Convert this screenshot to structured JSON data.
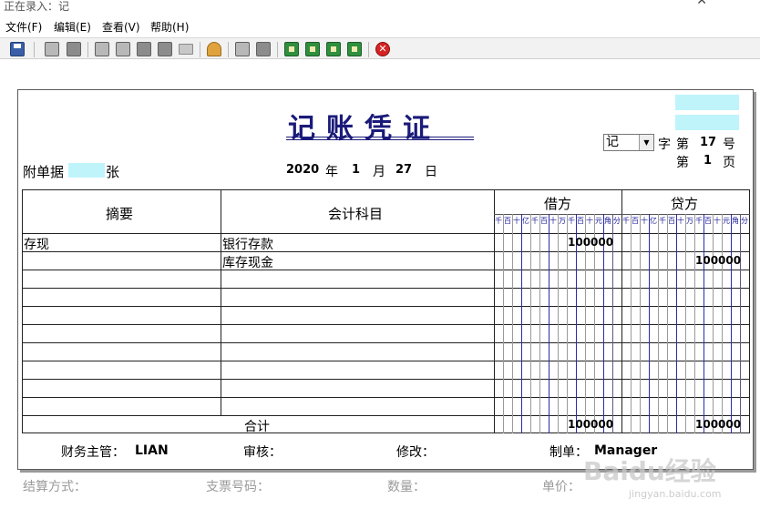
{
  "window": {
    "title": "正在录入：记"
  },
  "menu": {
    "file": "文件(F)",
    "edit": "编辑(E)",
    "view": "查看(V)",
    "help": "帮助(H)"
  },
  "voucher": {
    "title": "记账凭证",
    "kind": "记",
    "zi": "字",
    "di1": "第",
    "number": "17",
    "hao": "号",
    "di2": "第",
    "page": "1",
    "ye": "页",
    "attach_label": "附单据",
    "attach_unit": "张",
    "date_year": "2020",
    "date_year_unit": "年",
    "date_month": "1",
    "date_month_unit": "月",
    "date_day": "27",
    "date_day_unit": "日"
  },
  "table": {
    "headers": {
      "summary": "摘要",
      "account": "会计科目",
      "debit": "借方",
      "credit": "贷方"
    },
    "units": [
      "千",
      "百",
      "十",
      "亿",
      "千",
      "百",
      "十",
      "万",
      "千",
      "百",
      "十",
      "元",
      "角",
      "分"
    ],
    "rows": [
      {
        "summary": "存现",
        "account": "银行存款",
        "debit": "100000",
        "credit": ""
      },
      {
        "summary": "",
        "account": "库存现金",
        "debit": "",
        "credit": "100000"
      },
      {
        "summary": "",
        "account": "",
        "debit": "",
        "credit": ""
      },
      {
        "summary": "",
        "account": "",
        "debit": "",
        "credit": ""
      },
      {
        "summary": "",
        "account": "",
        "debit": "",
        "credit": ""
      },
      {
        "summary": "",
        "account": "",
        "debit": "",
        "credit": ""
      },
      {
        "summary": "",
        "account": "",
        "debit": "",
        "credit": ""
      },
      {
        "summary": "",
        "account": "",
        "debit": "",
        "credit": ""
      },
      {
        "summary": "",
        "account": "",
        "debit": "",
        "credit": ""
      },
      {
        "summary": "",
        "account": "",
        "debit": "",
        "credit": ""
      }
    ],
    "total_label": "合计",
    "total_debit": "100000",
    "total_credit": "100000"
  },
  "signatures": {
    "supervisor_label": "财务主管：",
    "supervisor_value": "LIAN",
    "review_label": "审核：",
    "modify_label": "修改：",
    "maker_label": "制单：",
    "maker_value": "Manager"
  },
  "bottom": {
    "settlement": "结算方式：",
    "cheque": "支票号码：",
    "quantity": "数量：",
    "price": "单价："
  },
  "watermark": {
    "brand": "Baidu经验",
    "url": "jingyan.baidu.com"
  },
  "colors": {
    "title": "#1a1a7a",
    "units": "#1a1a9a",
    "highlight": "#bff4fb"
  }
}
